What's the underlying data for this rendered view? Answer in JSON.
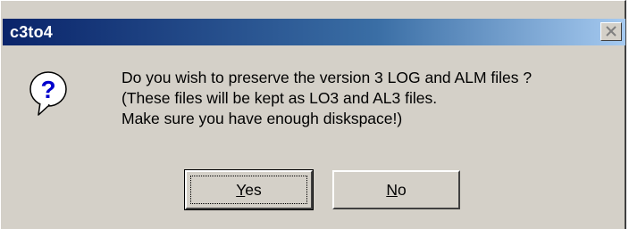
{
  "window": {
    "title": "c3to4"
  },
  "icons": {
    "question": "question-mark-balloon-icon",
    "close": "close-x-icon"
  },
  "message": {
    "line1": "Do you wish to preserve the version 3 LOG and ALM files ?",
    "line2": "(These files will be kept as LO3 and AL3 files.",
    "line3": "Make sure you have enough diskspace!)"
  },
  "buttons": {
    "yes": {
      "accel": "Y",
      "rest": "es"
    },
    "no": {
      "accel": "N",
      "rest": "o"
    }
  },
  "colors": {
    "titlebar_start": "#0a246a",
    "titlebar_end": "#a6caf0",
    "face": "#d4d0c8",
    "icon_blue": "#0000cc"
  }
}
